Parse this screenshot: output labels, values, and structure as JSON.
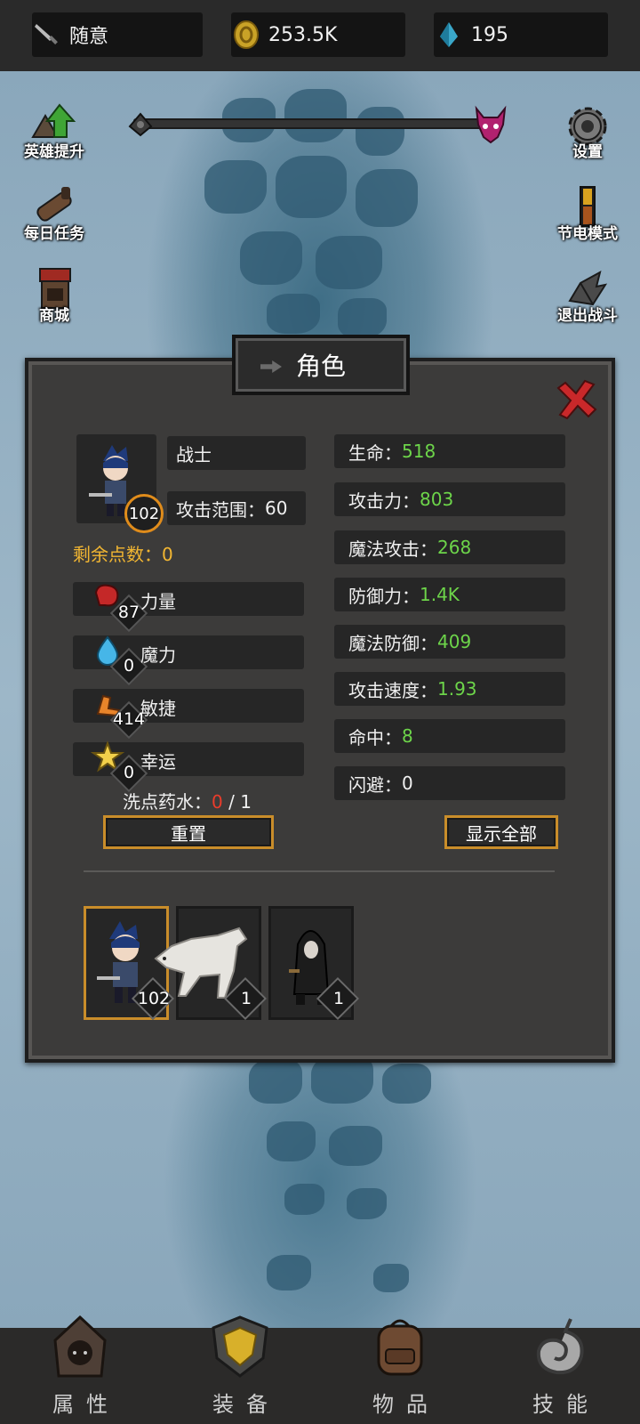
{
  "topbar": {
    "mode": {
      "label": "随意",
      "icon": "sword-icon"
    },
    "gold": {
      "value": "253.5K",
      "icon": "gold-coin-icon"
    },
    "gems": {
      "value": "195",
      "icon": "blue-crystal-icon"
    }
  },
  "left_menu": [
    {
      "label": "英雄提升",
      "icon": "hero-upgrade-icon"
    },
    {
      "label": "每日任务",
      "icon": "daily-quest-icon"
    },
    {
      "label": "商城",
      "icon": "shop-icon"
    }
  ],
  "right_menu": [
    {
      "label": "设置",
      "icon": "gear-icon"
    },
    {
      "label": "节电模式",
      "icon": "battery-icon"
    },
    {
      "label": "退出战斗",
      "icon": "exit-battle-icon"
    }
  ],
  "progress": {
    "start_icon": "player-marker-icon",
    "end_icon": "boss-demon-icon"
  },
  "panel": {
    "title": "角色",
    "hero": {
      "class": "战士",
      "attack_range_label": "攻击范围：",
      "attack_range": "60",
      "level": "102",
      "points_label": "剩余点数：",
      "points": "0"
    },
    "attributes": [
      {
        "name": "力量",
        "value": "87",
        "icon": "boxing-glove-icon"
      },
      {
        "name": "魔力",
        "value": "0",
        "icon": "water-drop-icon"
      },
      {
        "name": "敏捷",
        "value": "414",
        "icon": "winged-boot-icon"
      },
      {
        "name": "幸运",
        "value": "0",
        "icon": "star-icon"
      }
    ],
    "potion": {
      "label": "洗点药水：",
      "current": "0",
      "sep": " / ",
      "max": "1"
    },
    "reset_label": "重置",
    "show_all_label": "显示全部",
    "stats": [
      {
        "label": "生命：",
        "value": "518"
      },
      {
        "label": "攻击力：",
        "value": "803"
      },
      {
        "label": "魔法攻击：",
        "value": "268"
      },
      {
        "label": "防御力：",
        "value": "1.4K"
      },
      {
        "label": "魔法防御：",
        "value": "409"
      },
      {
        "label": "攻击速度：",
        "value": "1.93"
      },
      {
        "label": "命中：",
        "value": "8"
      },
      {
        "label": "闪避：",
        "value": "0"
      }
    ],
    "party": [
      {
        "name": "warrior",
        "level": "102",
        "selected": true
      },
      {
        "name": "white-wolf",
        "level": "1",
        "selected": false
      },
      {
        "name": "hooded-rogue",
        "level": "1",
        "selected": false
      }
    ]
  },
  "nav": [
    {
      "label": "属性",
      "icon": "hood-icon"
    },
    {
      "label": "装备",
      "icon": "shield-icon"
    },
    {
      "label": "物品",
      "icon": "backpack-icon"
    },
    {
      "label": "技能",
      "icon": "swirl-icon"
    }
  ],
  "colors": {
    "stat_value": "#6dd54a",
    "gold": "#c98d2a",
    "points": "#f2b632",
    "potion_current": "#ea3c2b"
  }
}
